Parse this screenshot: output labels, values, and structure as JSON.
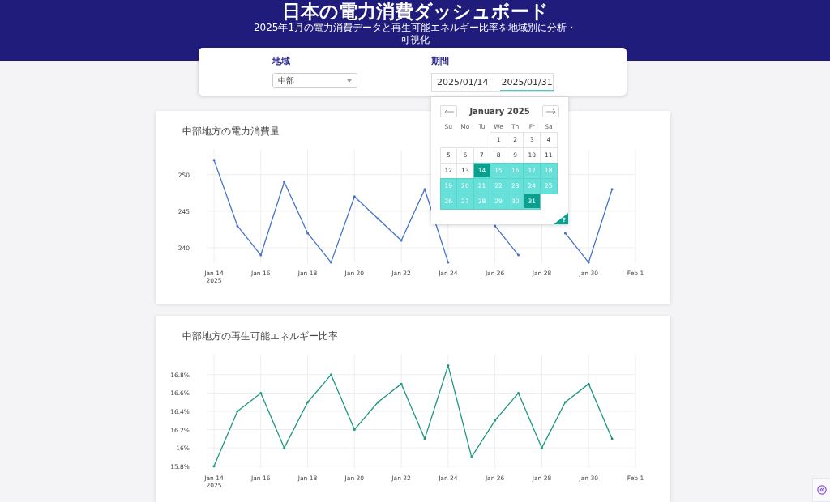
{
  "header": {
    "title": "日本の電力消費ダッシュボード",
    "subtitle": "2025年1月の電力消費データと再生可能エネルギー比率を地域別に分析・可視化"
  },
  "filters": {
    "region": {
      "label": "地域",
      "value": "中部"
    },
    "period": {
      "label": "期間",
      "start": "2025/01/14",
      "end": "2025/01/31",
      "end_focused": true
    }
  },
  "date_picker": {
    "month": "January 2025",
    "weekdays": [
      "Su",
      "Mo",
      "Tu",
      "We",
      "Th",
      "Fr",
      "Sa"
    ],
    "weeks": [
      [
        {
          "day": "1",
          "selected": false,
          "in_range": false
        },
        {
          "day": "2",
          "selected": false,
          "in_range": false
        },
        {
          "day": "3",
          "selected": false,
          "in_range": false
        },
        {
          "day": "4",
          "selected": false,
          "in_range": false
        }
      ],
      [
        {
          "day": "5",
          "selected": false,
          "in_range": false
        },
        {
          "day": "6",
          "selected": false,
          "in_range": false
        },
        {
          "day": "7",
          "selected": false,
          "in_range": false
        },
        {
          "day": "8",
          "selected": false,
          "in_range": false
        },
        {
          "day": "9",
          "selected": false,
          "in_range": false
        },
        {
          "day": "10",
          "selected": false,
          "in_range": false
        },
        {
          "day": "11",
          "selected": false,
          "in_range": false
        }
      ],
      [
        {
          "day": "12",
          "selected": false,
          "in_range": false
        },
        {
          "day": "13",
          "selected": false,
          "in_range": false
        },
        {
          "day": "14",
          "selected": true,
          "in_range": true
        },
        {
          "day": "15",
          "selected": false,
          "in_range": true
        },
        {
          "day": "16",
          "selected": false,
          "in_range": true
        },
        {
          "day": "17",
          "selected": false,
          "in_range": true
        },
        {
          "day": "18",
          "selected": false,
          "in_range": true
        }
      ],
      [
        {
          "day": "19",
          "selected": false,
          "in_range": true
        },
        {
          "day": "20",
          "selected": false,
          "in_range": true
        },
        {
          "day": "21",
          "selected": false,
          "in_range": true
        },
        {
          "day": "22",
          "selected": false,
          "in_range": true
        },
        {
          "day": "23",
          "selected": false,
          "in_range": true
        },
        {
          "day": "24",
          "selected": false,
          "in_range": true
        },
        {
          "day": "25",
          "selected": false,
          "in_range": true
        }
      ],
      [
        {
          "day": "26",
          "selected": false,
          "in_range": true
        },
        {
          "day": "27",
          "selected": false,
          "in_range": true
        },
        {
          "day": "28",
          "selected": false,
          "in_range": true
        },
        {
          "day": "29",
          "selected": false,
          "in_range": true
        },
        {
          "day": "30",
          "selected": false,
          "in_range": true
        },
        {
          "day": "31",
          "selected": true,
          "in_range": true
        }
      ]
    ],
    "help": "?"
  },
  "charts": [
    {
      "title": "中部地方の電力消費量",
      "x_year_label": "2025",
      "chart_data": {
        "type": "line",
        "grid": true,
        "categories": [
          "Jan 14",
          null,
          "Jan 16",
          null,
          "Jan 18",
          null,
          "Jan 20",
          null,
          "Jan 22",
          null,
          "Jan 24",
          null,
          "Jan 26",
          null,
          "Jan 28",
          null,
          "Jan 30",
          null,
          "Feb 1"
        ],
        "series": [
          {
            "color": "#4472ca",
            "values": [
              252,
              243,
              239,
              249,
              242,
              238,
              247,
              244,
              241,
              248,
              238,
              null,
              243,
              239,
              null,
              242,
              238,
              248,
              null
            ]
          }
        ],
        "ylim": [
          237.9,
          253.4
        ],
        "yticks": [
          240,
          245,
          250
        ]
      }
    },
    {
      "title": "中部地方の再生可能エネルギー比率",
      "x_year_label": "2025",
      "chart_data": {
        "type": "line",
        "grid": true,
        "categories": [
          "Jan 14",
          null,
          "Jan 16",
          null,
          "Jan 18",
          null,
          "Jan 20",
          null,
          "Jan 22",
          null,
          "Jan 24",
          null,
          "Jan 26",
          null,
          "Jan 28",
          null,
          "Jan 30",
          null,
          "Feb 1"
        ],
        "series": [
          {
            "color": "#1f9683",
            "values": [
              15.8,
              16.4,
              16.6,
              16.0,
              16.5,
              16.8,
              16.2,
              16.5,
              16.7,
              16.1,
              16.9,
              15.9,
              16.3,
              16.6,
              16.0,
              16.5,
              16.7,
              16.1,
              null
            ]
          }
        ],
        "ylim": [
          15.78,
          17.02
        ],
        "yticks": [
          {
            "value": 15.8,
            "label": "15.8%"
          },
          {
            "value": 16,
            "label": "16%"
          },
          {
            "value": 16.2,
            "label": "16.2%"
          },
          {
            "value": 16.4,
            "label": "16.4%"
          },
          {
            "value": 16.6,
            "label": "16.6%"
          },
          {
            "value": 16.8,
            "label": "16.8%"
          }
        ]
      }
    }
  ]
}
